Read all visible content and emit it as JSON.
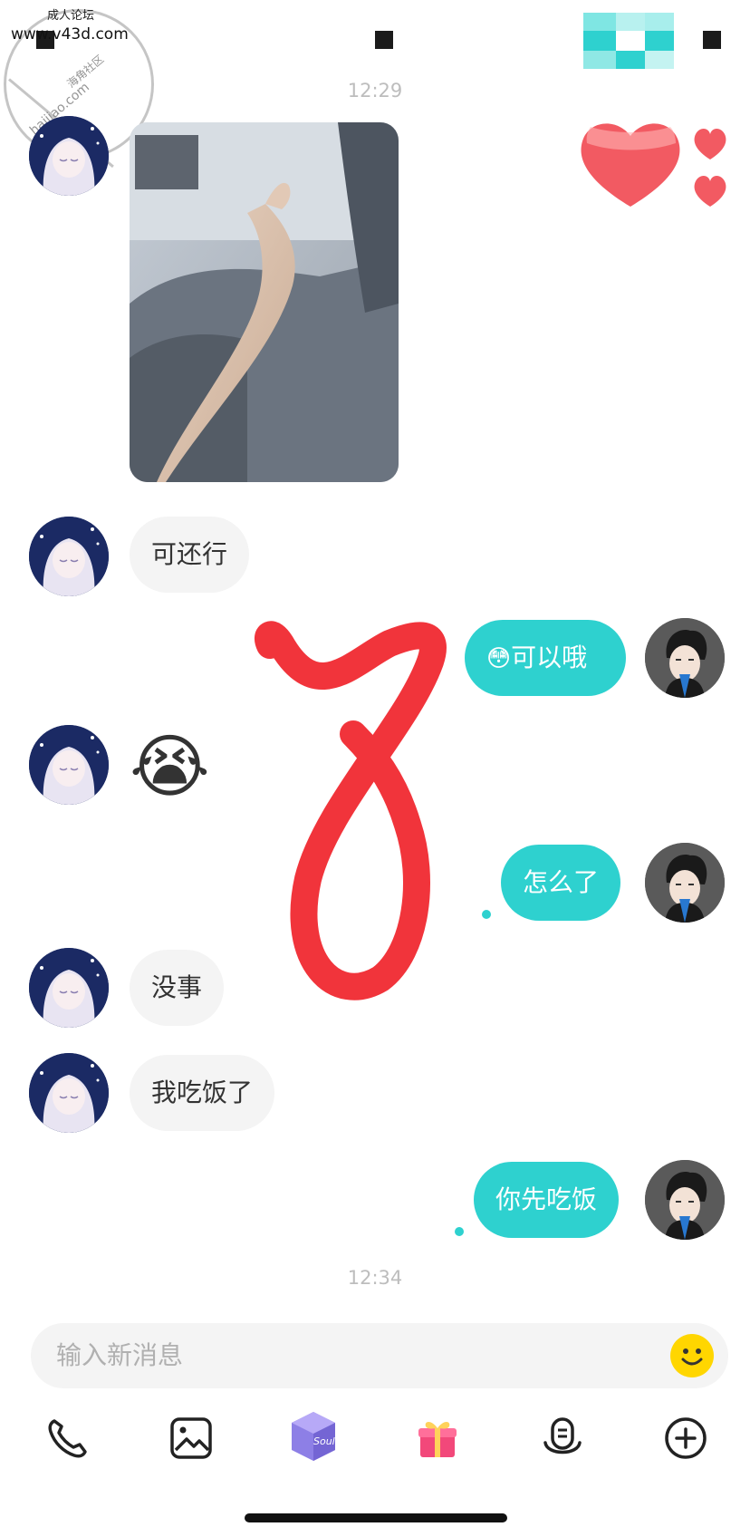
{
  "watermark": {
    "line1": "成人论坛",
    "line2": "www.v43d.com",
    "line3": "haijiao.com",
    "line4": "海角社区"
  },
  "timestamps": [
    "12:29",
    "12:34"
  ],
  "messages": [
    {
      "from": "them",
      "type": "image"
    },
    {
      "from": "them",
      "text": "可还行"
    },
    {
      "from": "me",
      "emoji": "😳",
      "text": "可以哦"
    },
    {
      "from": "them",
      "type": "emoji",
      "emoji": "😭"
    },
    {
      "from": "me",
      "text": "怎么了"
    },
    {
      "from": "them",
      "text": "没事"
    },
    {
      "from": "them",
      "text": "我吃饭了"
    },
    {
      "from": "me",
      "text": "你先吃饭"
    }
  ],
  "input": {
    "placeholder": "输入新消息"
  },
  "toolbar": {
    "box_label": "Soul",
    "icons": [
      "phone-icon",
      "image-icon",
      "soul-box-icon",
      "gift-icon",
      "voice-icon",
      "plus-icon"
    ]
  },
  "colors": {
    "accent": "#2ed1cf",
    "incoming_bubble": "#f4f4f4",
    "heart": "#f25a62",
    "overlay_mark": "#f0232a"
  }
}
